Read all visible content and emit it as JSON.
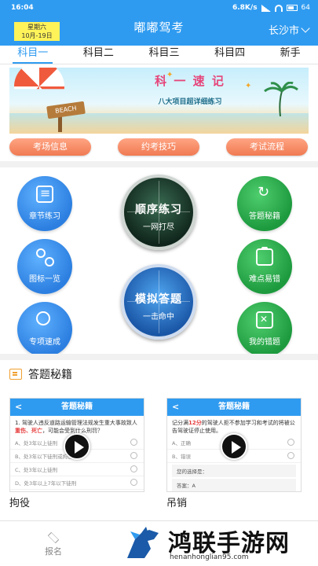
{
  "status": {
    "time": "16:04",
    "speed": "6.8K/s",
    "battery": "64"
  },
  "header": {
    "date_line1": "星期六",
    "date_line2": "10月-19日",
    "title": "嘟嘟驾考",
    "city": "长沙市"
  },
  "tabs": [
    "科目一",
    "科目二",
    "科目三",
    "科目四",
    "新手"
  ],
  "banner": {
    "headline": "科 一 速 记",
    "sub": "八大项目超详细练习",
    "sign": "BEACH"
  },
  "pills": [
    "考场信息",
    "约考技巧",
    "考试流程"
  ],
  "grid": {
    "left": [
      "章节练习",
      "图标一览",
      "专项速成"
    ],
    "right": [
      "答题秘籍",
      "难点易错",
      "我的错题"
    ],
    "center_top": {
      "main": "顺序练习",
      "sub": "一网打尽"
    },
    "center_bottom": {
      "main": "模拟答题",
      "sub": "一击命中"
    }
  },
  "secrets": {
    "title": "答题秘籍",
    "cards": [
      {
        "caption": "拘役",
        "bar": "答题秘籍",
        "q_pre": "1. 驾驶人违反道路运输管理法规发生重大事故致人",
        "q_em": "重伤、死亡",
        "q_post": "，可能会受到什么刑罚？",
        "options": [
          "A、处3年以上徒刑",
          "B、处3年以下徒刑或拘役",
          "C、处3年以上徒刑",
          "D、处3年以上7年以下徒刑"
        ]
      },
      {
        "caption": "吊销",
        "bar": "答题秘籍",
        "q_pre": "记分满",
        "q_em": "12分",
        "q_post": "的驾驶人拒不参加学习和考试的将被公告驾驶证停止使用。",
        "options": [
          "A、正确",
          "B、错误"
        ],
        "choice": "您的选择是：",
        "answer": "答案：A"
      }
    ]
  },
  "bottom": {
    "nav_label": "报名"
  },
  "watermark": {
    "text": "鸿联手游网",
    "url": "henanhonglian95.com"
  },
  "colors": {
    "brand": "#2f9bf0",
    "pill": "#f07a52",
    "green": "#1d9a3e",
    "blue": "#2c7fe0"
  }
}
